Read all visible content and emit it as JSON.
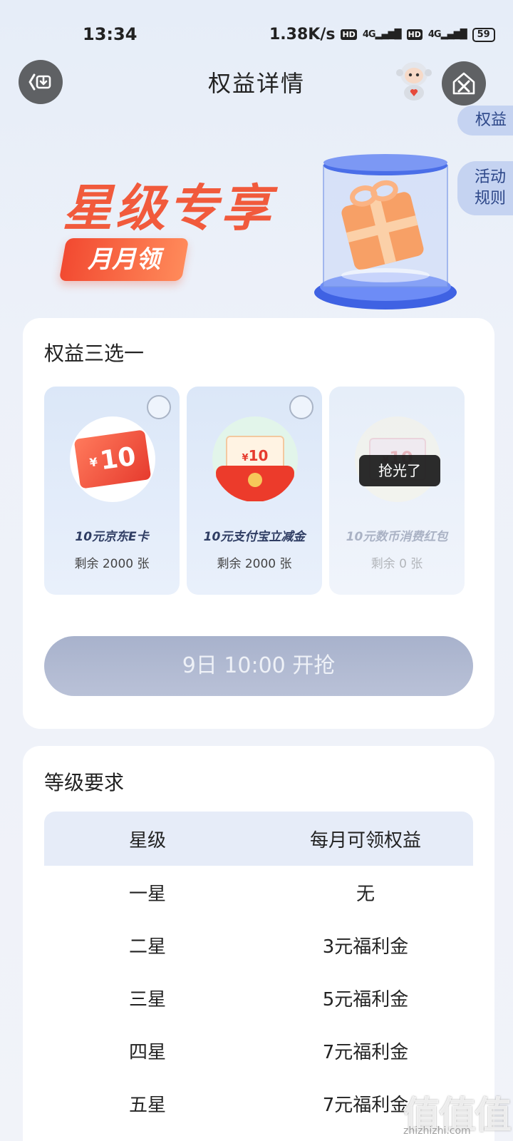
{
  "status_bar": {
    "time": "13:34",
    "speed": "1.38K/s",
    "hd1": "HD",
    "net1": "4G",
    "hd2": "HD",
    "net2": "4G",
    "battery": "59"
  },
  "header": {
    "title": "权益详情"
  },
  "side_tabs": {
    "quanyi": "权益",
    "rules_line1": "活动",
    "rules_line2": "规则"
  },
  "banner": {
    "title": "星级专享",
    "subtitle": "月月领"
  },
  "choose": {
    "title": "权益三选一",
    "options": [
      {
        "amount": "10",
        "currency": "¥",
        "name": "10元京东E卡",
        "remain": "剩余 2000 张",
        "sold_out": false
      },
      {
        "amount": "10",
        "currency": "¥",
        "name": "10元支付宝立减金",
        "remain": "剩余 2000 张",
        "sold_out": false
      },
      {
        "amount": "10",
        "currency": "¥",
        "name": "10元数币消费红包",
        "remain": "剩余 0 张",
        "sold_out": true
      }
    ],
    "sold_out_label": "抢光了",
    "button": "9日 10:00 开抢"
  },
  "levels": {
    "title": "等级要求",
    "headers": [
      "星级",
      "每月可领权益"
    ],
    "rows": [
      [
        "一星",
        "无"
      ],
      [
        "二星",
        "3元福利金"
      ],
      [
        "三星",
        "5元福利金"
      ],
      [
        "四星",
        "7元福利金"
      ],
      [
        "五星",
        "7元福利金"
      ]
    ]
  },
  "watermark": {
    "brand": "值值值",
    "url": "zhizhizhi.com"
  }
}
